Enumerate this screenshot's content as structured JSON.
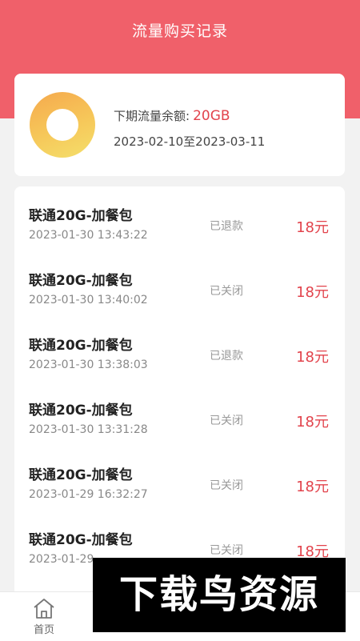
{
  "header": {
    "title": "流量购买记录"
  },
  "summary": {
    "label": "下期流量余额:",
    "value": "20GB",
    "period": "2023-02-10至2023-03-11"
  },
  "records": [
    {
      "name": "联通20G-加餐包",
      "time": "2023-01-30 13:43:22",
      "status": "已退款",
      "price": "18元"
    },
    {
      "name": "联通20G-加餐包",
      "time": "2023-01-30 13:40:02",
      "status": "已关闭",
      "price": "18元"
    },
    {
      "name": "联通20G-加餐包",
      "time": "2023-01-30 13:38:03",
      "status": "已退款",
      "price": "18元"
    },
    {
      "name": "联通20G-加餐包",
      "time": "2023-01-30 13:31:28",
      "status": "已关闭",
      "price": "18元"
    },
    {
      "name": "联通20G-加餐包",
      "time": "2023-01-29 16:32:27",
      "status": "已关闭",
      "price": "18元"
    },
    {
      "name": "联通20G-加餐包",
      "time": "2023-01-29",
      "status": "已关闭",
      "price": "18元"
    }
  ],
  "tabs": [
    {
      "label": "首页",
      "icon": "home-icon"
    },
    {
      "label": "",
      "icon": "record-icon"
    },
    {
      "label": "",
      "icon": "package-icon"
    },
    {
      "label": "",
      "icon": "profile-icon"
    }
  ],
  "watermark": {
    "text": "下载鸟资源"
  },
  "colors": {
    "accent": "#f0606a",
    "price": "#e2434c"
  }
}
